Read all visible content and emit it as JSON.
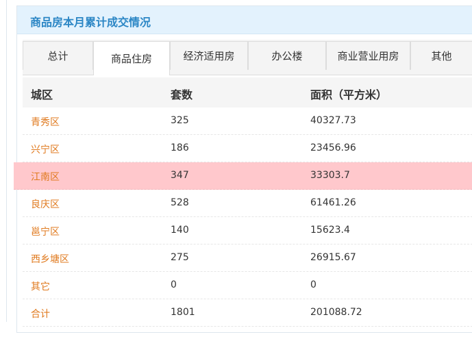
{
  "panel": {
    "title": "商品房本月累计成交情况"
  },
  "tabs": [
    {
      "label": "总计",
      "active": false
    },
    {
      "label": "商品住房",
      "active": true
    },
    {
      "label": "经济适用房",
      "active": false
    },
    {
      "label": "办公楼",
      "active": false
    },
    {
      "label": "商业营业用房",
      "active": false
    },
    {
      "label": "其他",
      "active": false
    }
  ],
  "table": {
    "headers": [
      "城区",
      "套数",
      "面积（平方米）"
    ],
    "rows": [
      {
        "district": "青秀区",
        "units": "325",
        "area": "40327.73",
        "highlighted": false
      },
      {
        "district": "兴宁区",
        "units": "186",
        "area": "23456.96",
        "highlighted": false
      },
      {
        "district": "江南区",
        "units": "347",
        "area": "33303.7",
        "highlighted": true
      },
      {
        "district": "良庆区",
        "units": "528",
        "area": "61461.26",
        "highlighted": false
      },
      {
        "district": "邕宁区",
        "units": "140",
        "area": "15623.4",
        "highlighted": false
      },
      {
        "district": "西乡塘区",
        "units": "275",
        "area": "26915.67",
        "highlighted": false
      },
      {
        "district": "其它",
        "units": "0",
        "area": "0",
        "highlighted": false
      },
      {
        "district": "合计",
        "units": "1801",
        "area": "201088.72",
        "highlighted": false
      }
    ]
  },
  "colors": {
    "title": "#2b86c5",
    "header_bg": "#e3f2fd",
    "district_link": "#e07a1f",
    "row_highlight": "#ffc8cc"
  }
}
